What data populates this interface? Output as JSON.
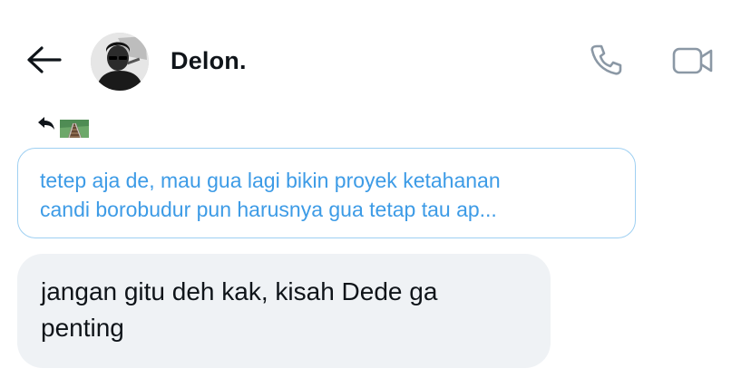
{
  "header": {
    "contact_name": "Delon.",
    "back_icon": "arrow-left-icon",
    "call_icon": "phone-icon",
    "video_icon": "video-camera-icon"
  },
  "reply": {
    "reply_icon": "reply-arrow-icon",
    "reacted_emoji": "railway-track-emoji"
  },
  "quoted_message": {
    "lines": [
      "tetep aja de, mau gua lagi bikin proyek ketahanan",
      "candi borobudur pun harusnya gua tetap tau ap..."
    ]
  },
  "message": {
    "lines": [
      "jangan gitu deh kak, kisah Dede ga",
      "penting"
    ]
  },
  "colors": {
    "quote_text": "#3d9be6",
    "quote_border": "#9fd0f2",
    "bubble_bg": "#eff2f5",
    "text": "#0f1419",
    "icon_gray": "#8b98a5"
  }
}
